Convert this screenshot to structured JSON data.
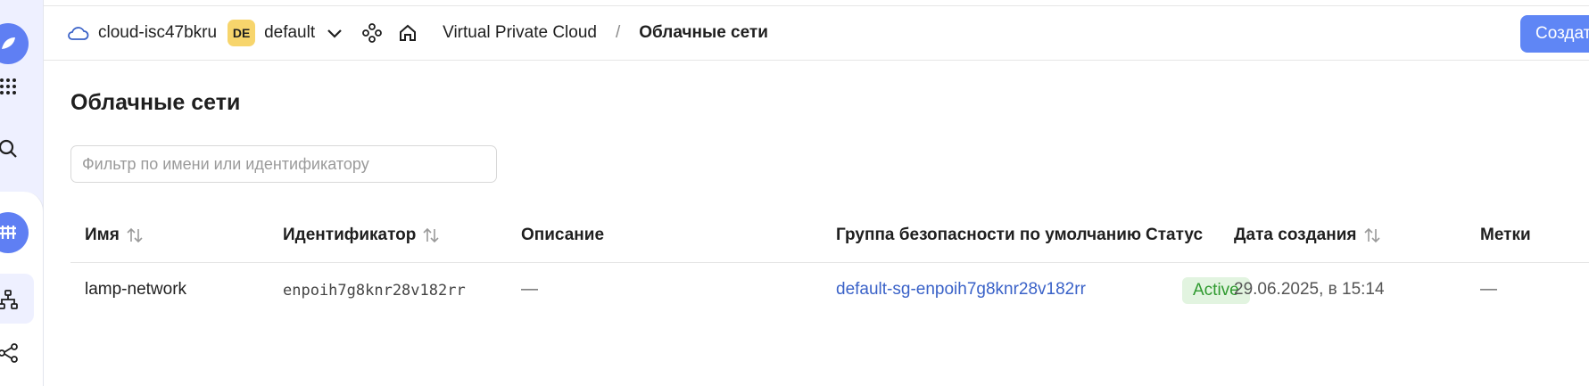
{
  "header": {
    "cloud_name": "cloud-isc47bkru",
    "folder_badge": "DE",
    "folder_name": "default",
    "breadcrumb_service": "Virtual Private Cloud",
    "breadcrumb_separator": "/",
    "breadcrumb_current": "Облачные сети",
    "create_button_label": "Создат"
  },
  "main": {
    "title": "Облачные сети",
    "filter_placeholder": "Фильтр по имени или идентификатору"
  },
  "table": {
    "columns": [
      "Имя",
      "Идентификатор",
      "Описание",
      "Группа безопасности по умолчанию",
      "Статус",
      "Дата создания",
      "Метки"
    ],
    "rows": [
      {
        "name": "lamp-network",
        "id": "enpoih7g8knr28v182rr",
        "description": "—",
        "security_group": "default-sg-enpoih7g8knr28v182rr",
        "status": "Active",
        "created": "29.06.2025, в 15:14",
        "labels": "—"
      }
    ]
  },
  "colors": {
    "accent": "#5f86f5",
    "link": "#3a62c8",
    "status_active_bg": "#e2f4e0",
    "status_active_text": "#2f9a2f",
    "folder_badge_bg": "#f7d56c"
  },
  "icons": {
    "rail": [
      "logo-icon",
      "services-grid-icon",
      "search-icon",
      "vpc-service-icon",
      "networks-icon",
      "connections-icon"
    ],
    "header": [
      "cloud-icon",
      "chevron-down-icon",
      "nodes-icon",
      "home-icon"
    ]
  }
}
